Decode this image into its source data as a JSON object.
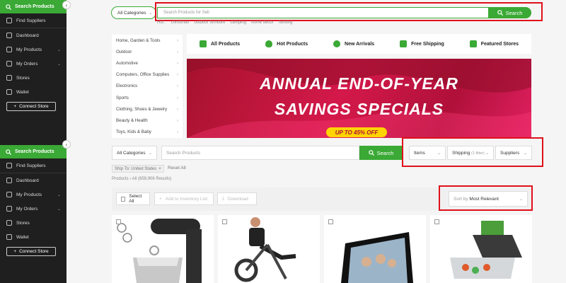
{
  "sidebar": {
    "search_label": "Search Products",
    "items": [
      {
        "label": "Find Suppliers",
        "icon": "store-icon"
      },
      {
        "label": "Dashboard",
        "icon": "dashboard-icon"
      },
      {
        "label": "My Products",
        "icon": "box-icon"
      },
      {
        "label": "My Orders",
        "icon": "cart-icon"
      },
      {
        "label": "Stores",
        "icon": "store-icon"
      },
      {
        "label": "Wallet",
        "icon": "wallet-icon"
      }
    ],
    "connect_label": "Connect Store"
  },
  "top_search": {
    "category": "All Categories",
    "placeholder": "Search Products for Sell",
    "button": "Search",
    "hot_label": "Hot :",
    "hot_terms": [
      "christmas",
      "outdoor furniture",
      "camping",
      "home decor",
      "hunting"
    ]
  },
  "categories": [
    "Home, Garden & Tools",
    "Outdoor",
    "Automotive",
    "Computers, Office Supplies",
    "Electronics",
    "Sports",
    "Clothing, Shoes & Jewelry",
    "Beauty & Health",
    "Toys, Kids & Baby"
  ],
  "features": [
    "All Products",
    "Hot Products",
    "New Arrivals",
    "Free Shipping",
    "Featured Stores"
  ],
  "banner": {
    "line1": "ANNUAL END-OF-YEAR",
    "line2": "SAVINGS SPECIALS",
    "offer": "UP TO 45% OFF"
  },
  "filter": {
    "category": "All Categories",
    "placeholder": "Search Products",
    "button": "Search",
    "items": "Items",
    "shipping": "Shipping",
    "shipping_count": "(1 filter)",
    "suppliers": "Suppliers",
    "chip": "Ship To: United States",
    "chip_close": "×",
    "reset": "Reset All",
    "breadcrumb": "Products  ›  All  (659,906 Results)"
  },
  "bulk": {
    "select_all": "Select All",
    "add_inventory": "Add to Inventory List",
    "download": "Download",
    "sort_prefix": "Sort by",
    "sort_value": "Most Relevant"
  },
  "products": [
    "stand mixer",
    "exercise bike",
    "digital photo frame",
    "vegetable chopper"
  ],
  "colors": {
    "brand_green": "#3aa935",
    "sidebar_bg": "#1f1f1f",
    "highlight_red": "#e0101a",
    "banner_red": "#c8163f",
    "offer_yellow": "#ffd400"
  }
}
